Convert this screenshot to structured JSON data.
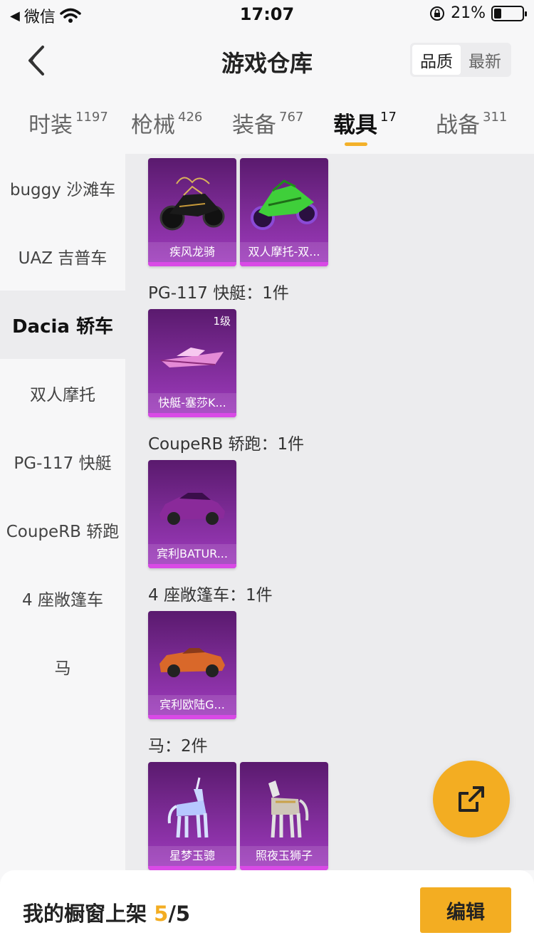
{
  "status": {
    "carrier": "微信",
    "time": "17:07",
    "battery": "21%"
  },
  "header": {
    "title": "游戏仓库",
    "sort": [
      "品质",
      "最新"
    ],
    "sort_active": "品质"
  },
  "tabs": [
    {
      "label": "时装",
      "count": "1197"
    },
    {
      "label": "枪械",
      "count": "426"
    },
    {
      "label": "装备",
      "count": "767"
    },
    {
      "label": "载具",
      "count": "17"
    },
    {
      "label": "战备",
      "count": "311"
    }
  ],
  "sidebar": {
    "items": [
      "buggy 沙滩车",
      "UAZ 吉普车",
      "Dacia 轿车",
      "双人摩托",
      "PG-117 快艇",
      "CoupeRB 轿跑",
      "4 座敞篷车",
      "马"
    ],
    "active": "Dacia 轿车"
  },
  "groups": [
    {
      "title": "",
      "items": [
        {
          "name": "疾风龙骑",
          "icon": "motorcycle-black-gold"
        },
        {
          "name": "双人摩托-双...",
          "icon": "motorcycle-green"
        }
      ]
    },
    {
      "title": "PG-117 快艇：1件",
      "items": [
        {
          "name": "快艇-塞莎K...",
          "icon": "speedboat-pink",
          "level": "1级"
        }
      ]
    },
    {
      "title": "CoupeRB 轿跑：1件",
      "items": [
        {
          "name": "宾利BATUR...",
          "icon": "coupe-purple"
        }
      ]
    },
    {
      "title": "4 座敞篷车：1件",
      "items": [
        {
          "name": "宾利欧陆G...",
          "icon": "convertible-orange"
        }
      ]
    },
    {
      "title": "马：2件",
      "items": [
        {
          "name": "星梦玉骢",
          "icon": "unicorn-blue"
        },
        {
          "name": "照夜玉狮子",
          "icon": "horse-armored"
        }
      ]
    }
  ],
  "bottom": {
    "label": "我的橱窗上架",
    "current": "5",
    "total": "/5",
    "edit": "编辑"
  },
  "colors": {
    "accent": "#f3ad22",
    "card_purple": "#7a2a93"
  }
}
